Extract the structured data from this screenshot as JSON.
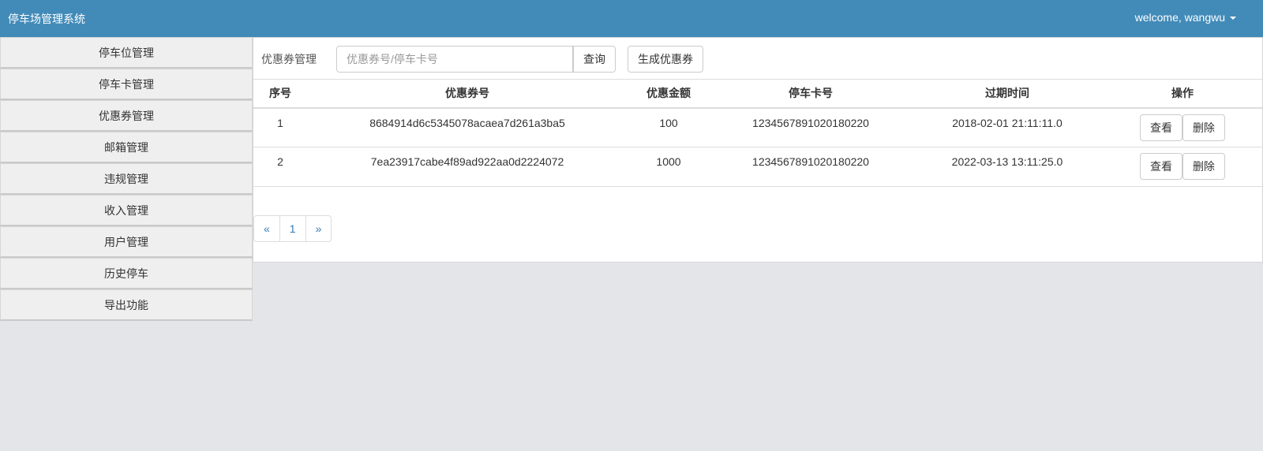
{
  "header": {
    "brand": "停车场管理系统",
    "user_greeting": "welcome, wangwu"
  },
  "sidebar": {
    "items": [
      {
        "label": "停车位管理"
      },
      {
        "label": "停车卡管理"
      },
      {
        "label": "优惠券管理"
      },
      {
        "label": "邮箱管理"
      },
      {
        "label": "违规管理"
      },
      {
        "label": "收入管理"
      },
      {
        "label": "用户管理"
      },
      {
        "label": "历史停车"
      },
      {
        "label": "导出功能"
      }
    ]
  },
  "toolbar": {
    "title": "优惠券管理",
    "search_placeholder": "优惠券号/停车卡号",
    "search_value": "",
    "query_label": "查询",
    "generate_label": "生成优惠券"
  },
  "table": {
    "columns": [
      "序号",
      "优惠券号",
      "优惠金额",
      "停车卡号",
      "过期时间",
      "操作"
    ],
    "rows": [
      {
        "index": "1",
        "coupon_no": "8684914d6c5345078acaea7d261a3ba5",
        "amount": "100",
        "card_no": "1234567891020180220",
        "expire_time": "2018-02-01 21:11:11.0",
        "view_label": "查看",
        "delete_label": "删除"
      },
      {
        "index": "2",
        "coupon_no": "7ea23917cabe4f89ad922aa0d2224072",
        "amount": "1000",
        "card_no": "1234567891020180220",
        "expire_time": "2022-03-13 13:11:25.0",
        "view_label": "查看",
        "delete_label": "删除"
      }
    ]
  },
  "pagination": {
    "prev": "«",
    "pages": [
      "1"
    ],
    "next": "»"
  },
  "colors": {
    "header_bg": "#428bb9",
    "page_bg": "#e4e5e8",
    "link": "#337ab7"
  }
}
